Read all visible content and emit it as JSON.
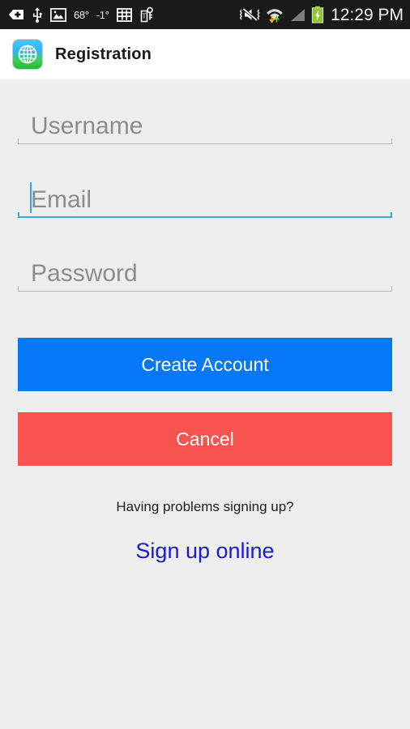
{
  "status_bar": {
    "icons_left": [
      {
        "name": "add-tag-icon",
        "label": "+"
      },
      {
        "name": "usb-icon",
        "label": "USB"
      },
      {
        "name": "image-gallery-icon",
        "label": "Gallery"
      }
    ],
    "temperature_primary": "68°",
    "temperature_secondary": "-1°",
    "icons_left_after": [
      {
        "name": "calculator-grid-icon",
        "label": "Grid"
      },
      {
        "name": "tmobile-key-tag-icon",
        "label": "T-Mobile"
      }
    ],
    "icons_right": [
      {
        "name": "sound-muted-vibrate-icon",
        "label": "Muted"
      },
      {
        "name": "wifi-data-transfer-icon",
        "label": "Wi-Fi"
      },
      {
        "name": "cell-signal-icon",
        "label": "Signal"
      },
      {
        "name": "battery-charging-icon",
        "label": "Charging"
      }
    ],
    "clock": "12:29 PM"
  },
  "app_bar": {
    "icon_name": "globe-app-icon",
    "title": "Registration"
  },
  "form": {
    "fields": [
      {
        "id": "username",
        "placeholder": "Username",
        "value": "",
        "focused": false
      },
      {
        "id": "email",
        "placeholder": "Email",
        "value": "",
        "focused": true
      },
      {
        "id": "password",
        "placeholder": "Password",
        "value": "",
        "focused": false
      }
    ],
    "username_placeholder": "Username",
    "email_placeholder": "Email",
    "password_placeholder": "Password",
    "create_account_label": "Create Account",
    "cancel_label": "Cancel",
    "help_text": "Having problems signing up?",
    "signup_link_label": "Sign up online"
  },
  "colors": {
    "primary_button": "#0578f5",
    "cancel_button": "#f8534f",
    "link": "#1a1ad2",
    "focus_underline": "#33a9dc",
    "idle_underline": "#b9b9b9",
    "placeholder_text": "#8d8d8d",
    "page_background": "#efeeee",
    "app_bar_background": "#ffffff",
    "status_bar_background": "#1a1a1a"
  }
}
